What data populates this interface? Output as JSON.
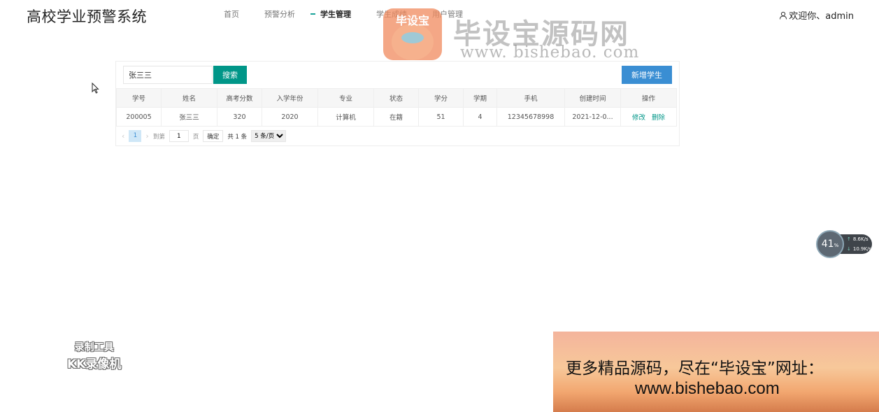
{
  "header": {
    "app_title": "高校学业预警系统",
    "nav": [
      {
        "label": "首页",
        "active": false
      },
      {
        "label": "预警分析",
        "active": false
      },
      {
        "label": "学生管理",
        "active": true
      },
      {
        "label": "学生成绩",
        "active": false
      },
      {
        "label": "用户管理",
        "active": false
      }
    ],
    "user_label": "欢迎你、admin"
  },
  "toolbar": {
    "search_value": "张三三",
    "search_button": "搜索",
    "add_button": "新增学生"
  },
  "table": {
    "columns": [
      "学号",
      "姓名",
      "高考分数",
      "入学年份",
      "专业",
      "状态",
      "学分",
      "学期",
      "手机",
      "创建时间",
      "操作"
    ],
    "rows": [
      {
        "id": "200005",
        "name": "张三三",
        "score": "320",
        "year": "2020",
        "major": "计算机",
        "status": "在籍",
        "credit": "51",
        "term": "4",
        "phone": "12345678998",
        "created": "2021-12-0...",
        "edit": "修改",
        "delete": "删除"
      }
    ]
  },
  "pagination": {
    "current_page": "1",
    "goto_label": "到第",
    "goto_value": "1",
    "page_unit": "页",
    "confirm": "确定",
    "total": "共 1 条",
    "page_size": "5 条/页"
  },
  "overlays": {
    "watermark_title": "毕设宝源码网",
    "watermark_url": "www. bishebao. com",
    "watermark_badge": "毕设宝",
    "net_percent": "41",
    "net_percent_unit": "%",
    "net_up": "8.6",
    "net_down": "10.9",
    "net_unit": "K/s",
    "recorder_line1": "录制工具",
    "recorder_line2": "KK录像机",
    "banner_line1": "更多精品源码，尽在“毕设宝”网址：",
    "banner_line2": "www.bishebao.com"
  },
  "colors": {
    "primary": "#009688",
    "accent_blue": "#3a8ed3"
  }
}
